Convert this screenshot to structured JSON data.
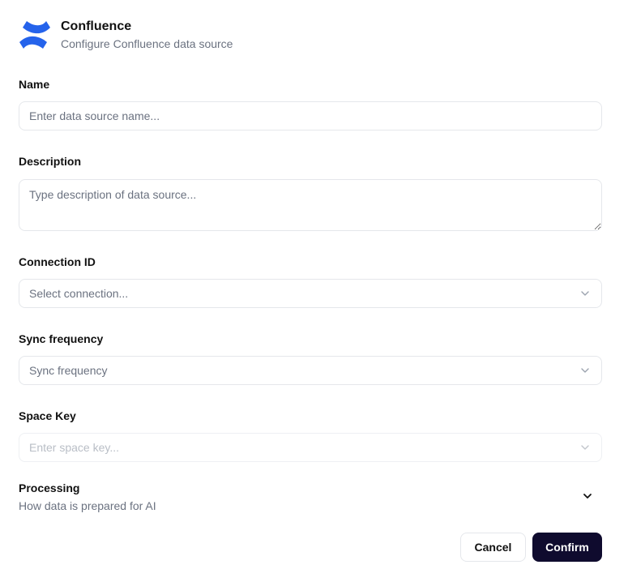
{
  "header": {
    "title": "Confluence",
    "subtitle": "Configure Confluence data source",
    "logo_icon": "confluence-logo-icon",
    "logo_color": "#2563eb"
  },
  "form": {
    "name": {
      "label": "Name",
      "placeholder": "Enter data source name...",
      "value": ""
    },
    "description": {
      "label": "Description",
      "placeholder": "Type description of data source...",
      "value": ""
    },
    "connection_id": {
      "label": "Connection ID",
      "selected": "Select connection..."
    },
    "sync_frequency": {
      "label": "Sync frequency",
      "selected": "Sync frequency"
    },
    "space_key": {
      "label": "Space Key",
      "placeholder": "Enter space key...",
      "disabled": true
    },
    "processing": {
      "title": "Processing",
      "subtitle": "How data is prepared for AI",
      "expanded": false
    }
  },
  "actions": {
    "cancel_label": "Cancel",
    "confirm_label": "Confirm"
  },
  "colors": {
    "primary_button": "#0f0b2e",
    "border": "#e5e7eb",
    "muted_text": "#6b7280"
  }
}
